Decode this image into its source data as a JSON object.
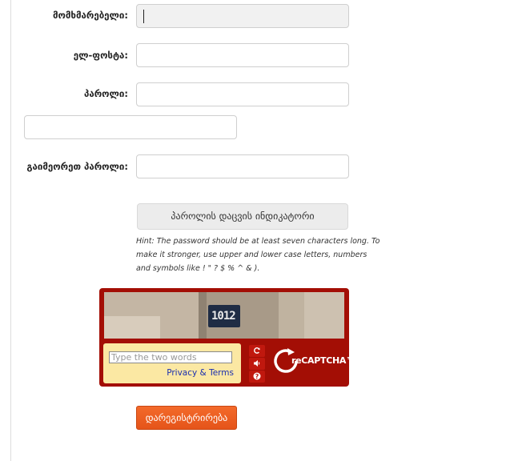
{
  "form": {
    "username_label": "მომხმარებელი:",
    "email_label": "ელ-ფოსტა:",
    "password_label": "პაროლი:",
    "confirm_label": "გაიმეორეთ პაროლი:",
    "strength_label": "პაროლის დაცვის ინდიკატორი",
    "hint": "Hint: The password should be at least seven characters long. To make it stronger, use upper and lower case letters, numbers and symbols like ! \" ? $ % ^ & ).",
    "submit_label": "დარეგისტრირება"
  },
  "captcha": {
    "image_text": "1012",
    "placeholder": "Type the two words",
    "privacy_link": "Privacy & Terms",
    "brand_text": "reCAPTCHA™",
    "icons": [
      "refresh-icon",
      "audio-icon",
      "help-icon"
    ],
    "colors": {
      "frame": "#a30e05",
      "input_bg": "#fbe8a3"
    }
  },
  "colors": {
    "submit": "#ee6023",
    "link": "#1a2fb0"
  }
}
